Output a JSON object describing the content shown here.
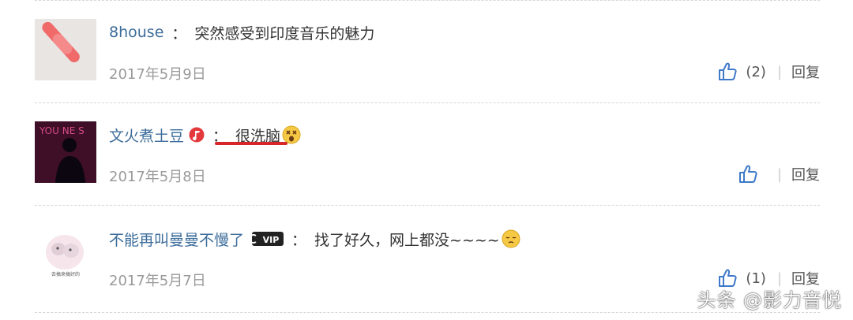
{
  "comments": [
    {
      "username": "8house",
      "text": "突然感受到印度音乐的魅力",
      "date": "2017年5月9日",
      "like_count": "(2)",
      "reply_label": "回复"
    },
    {
      "username": "文火煮土豆",
      "text": "很洗脑",
      "date": "2017年5月8日",
      "like_count": "",
      "reply_label": "回复",
      "avatar_text": "YOU NE S"
    },
    {
      "username": "不能再叫曼曼不慢了",
      "text": "找了好久，网上都没~~~~",
      "date": "2017年5月7日",
      "like_count": "(1)",
      "reply_label": "回复",
      "badge": "VIP",
      "avatar_caption": "去搞来搞好的"
    }
  ],
  "separator": "|",
  "colon": "：",
  "watermark": "头条 @影力音悦",
  "colors": {
    "username": "#3d6d9b",
    "like_icon": "#3f7ac9",
    "highlight_underline": "#d7262a"
  },
  "icons": {
    "like": "thumbs-up-icon",
    "music_badge": "music-badge-icon",
    "vip_badge": "vip-badge-icon",
    "emoji_dizzy": "dizzy-face-emoji-icon",
    "emoji_pensive": "pensive-face-emoji-icon"
  }
}
